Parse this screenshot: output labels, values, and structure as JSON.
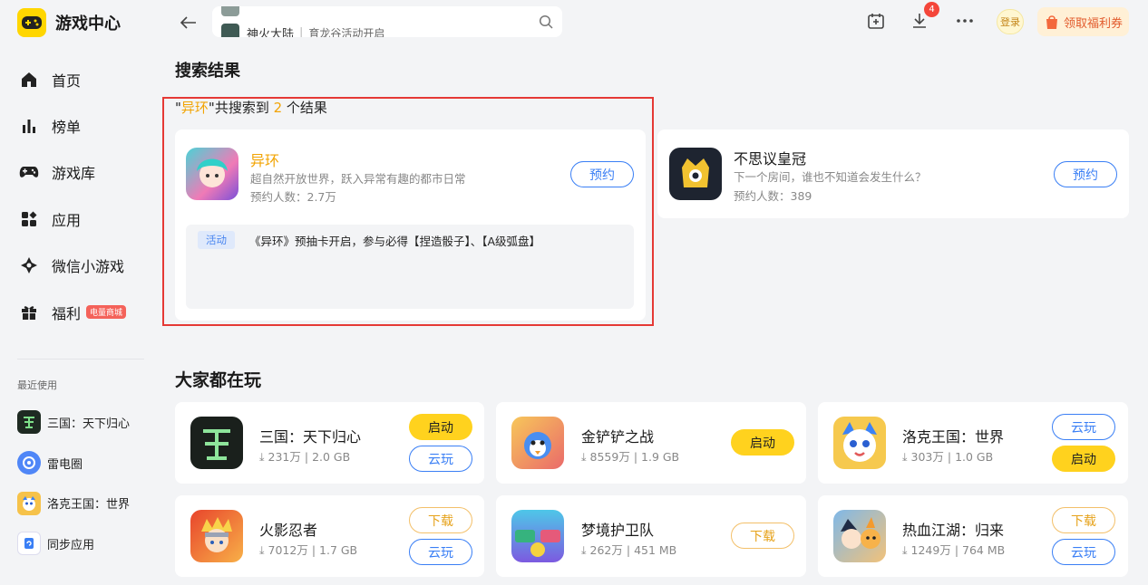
{
  "app": {
    "title": "游戏中心"
  },
  "sidebar": {
    "nav": [
      {
        "label": "首页",
        "icon": "home-icon"
      },
      {
        "label": "榜单",
        "icon": "chart-icon"
      },
      {
        "label": "游戏库",
        "icon": "gamepad-icon"
      },
      {
        "label": "应用",
        "icon": "apps-icon"
      },
      {
        "label": "微信小游戏",
        "icon": "wechat-game-icon"
      },
      {
        "label": "福利",
        "icon": "gift-icon",
        "badge": "电量商城"
      }
    ],
    "recent_title": "最近使用",
    "recent": [
      {
        "label": "三国：天下归心"
      },
      {
        "label": "雷电圈"
      },
      {
        "label": "洛克王国：世界"
      },
      {
        "label": "同步应用"
      }
    ]
  },
  "header": {
    "search_suggestion": {
      "name": "神火大陆",
      "sub": "育龙谷活动开启"
    },
    "download_count": "4",
    "login_label": "登录",
    "coupon_label": "领取福利券"
  },
  "search": {
    "section_title": "搜索结果",
    "summary": {
      "quote_open": "\"",
      "keyword": "异环",
      "quote_close": "\"",
      "middle": "共搜索到 ",
      "count": "2",
      "suffix": " 个结果"
    },
    "results": [
      {
        "name": "异环",
        "desc": "超自然开放世界，跃入异常有趣的都市日常",
        "meta": "预约人数：2.7万",
        "button": "预约",
        "activity_tag": "活动",
        "activity_text": "《异环》预抽卡开启，参与必得【捏造骰子】、【A级弧盘】"
      },
      {
        "name": "不思议皇冠",
        "desc": "下一个房间，谁也不知道会发生什么？",
        "meta": "预约人数：389",
        "button": "预约"
      }
    ]
  },
  "popular": {
    "section_title": "大家都在玩",
    "games": [
      {
        "name": "三国：天下归心",
        "downloads": "231万",
        "size": "2.0 GB",
        "primary": "启动",
        "secondary": "云玩"
      },
      {
        "name": "金铲铲之战",
        "downloads": "8559万",
        "size": "1.9 GB",
        "primary": "启动"
      },
      {
        "name": "洛克王国：世界",
        "downloads": "303万",
        "size": "1.0 GB",
        "primary": "启动",
        "secondary": "云玩"
      },
      {
        "name": "火影忍者",
        "downloads": "7012万",
        "size": "1.7 GB",
        "primary": "下载",
        "secondary": "云玩"
      },
      {
        "name": "梦境护卫队",
        "downloads": "262万",
        "size": "451 MB",
        "primary": "下载"
      },
      {
        "name": "热血江湖：归来",
        "downloads": "1249万",
        "size": "764 MB",
        "primary": "下载",
        "secondary": "云玩"
      }
    ],
    "meta_separator": "|",
    "download_glyph": "⤓"
  },
  "colors": {
    "accent_yellow": "#ffd21e",
    "accent_blue": "#3a7ff5",
    "highlight_red": "#e53935",
    "keyword_orange": "#f2a404"
  }
}
